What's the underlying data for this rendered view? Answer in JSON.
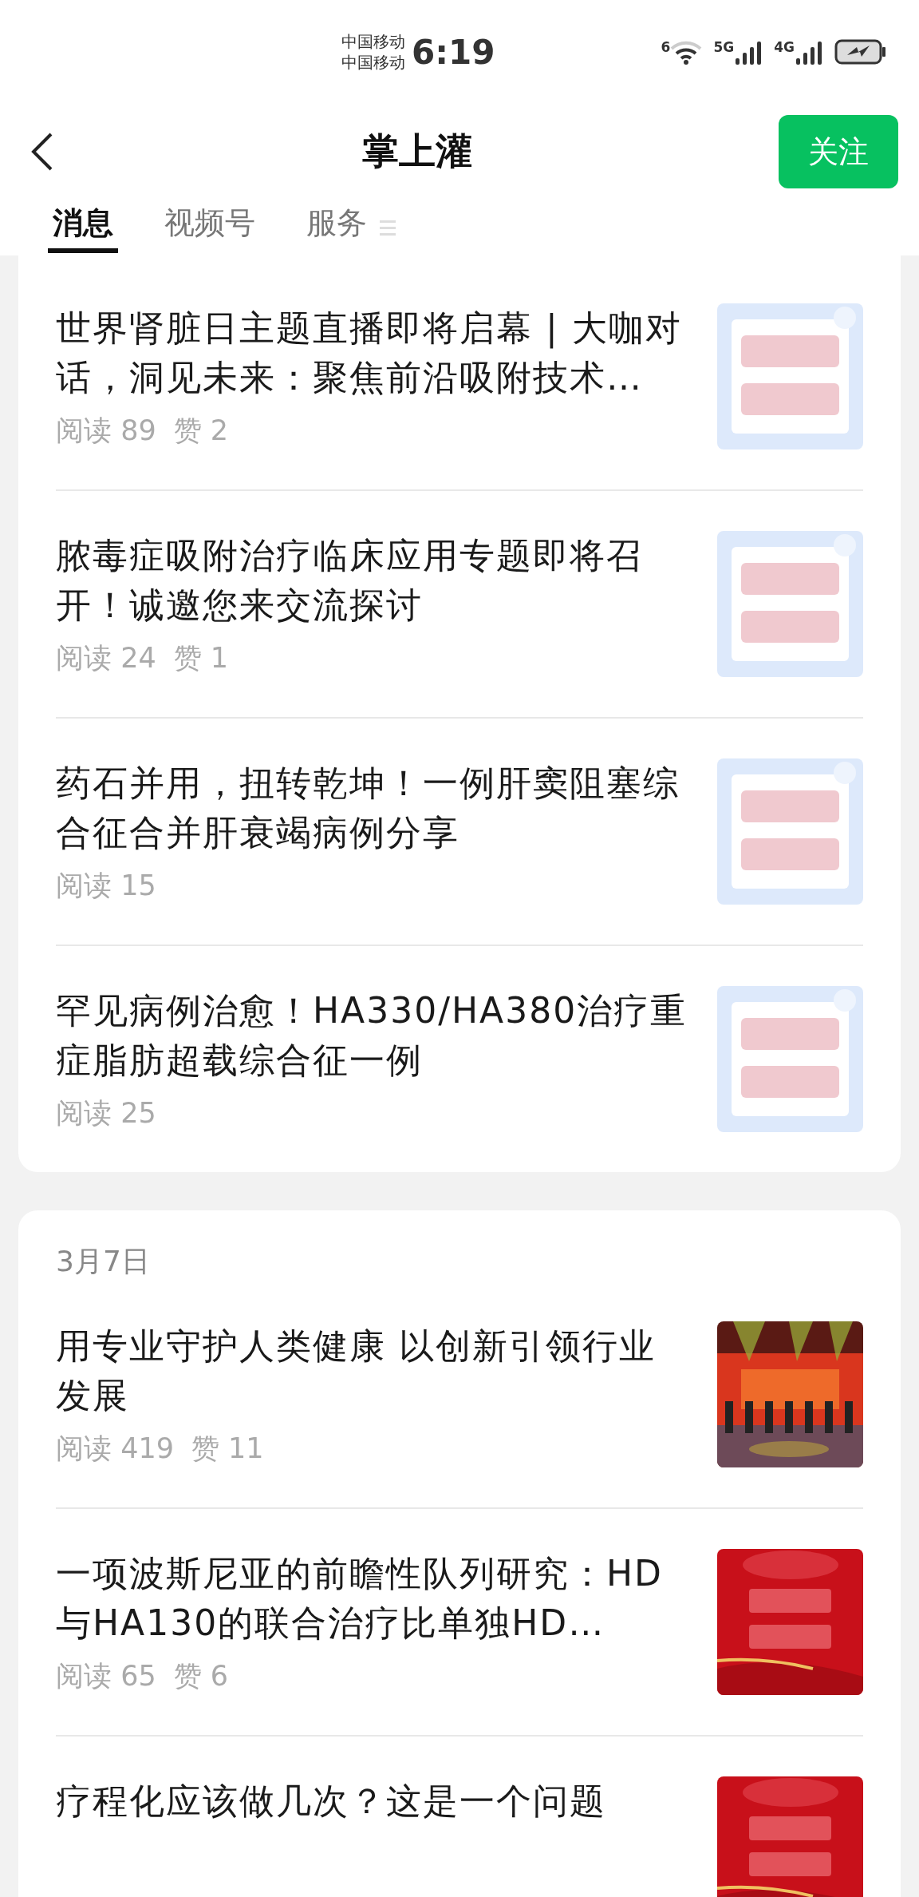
{
  "status_bar": {
    "carriers": [
      "中国移动",
      "中国移动"
    ],
    "time": "6:19",
    "wifi_label": "6",
    "signals": [
      {
        "label": "5G"
      },
      {
        "label": "4G"
      }
    ]
  },
  "header": {
    "title": "掌上灌",
    "follow_button": "关注"
  },
  "tabs": [
    {
      "label": "消息",
      "selected": true
    },
    {
      "label": "视频号",
      "selected": false
    },
    {
      "label": "服务",
      "selected": false
    }
  ],
  "groups": [
    {
      "articles": [
        {
          "title": "世界肾脏日主题直播即将启幕 | 大咖对话，洞见未来：聚焦前沿吸附技术…",
          "reads": "阅读 89",
          "likes": "赞 2",
          "thumb": {
            "kind": "light"
          }
        },
        {
          "title": "脓毒症吸附治疗临床应用专题即将召开！诚邀您来交流探讨",
          "reads": "阅读 24",
          "likes": "赞 1",
          "thumb": {
            "kind": "light"
          }
        },
        {
          "title": "药石并用，扭转乾坤！一例肝窦阻塞综合征合并肝衰竭病例分享",
          "reads": "阅读 15",
          "thumb": {
            "kind": "light"
          }
        },
        {
          "title": "罕见病例治愈！HA330/HA380治疗重症脂肪超载综合征一例",
          "reads": "阅读 25",
          "thumb": {
            "kind": "light"
          }
        }
      ]
    },
    {
      "date": "3月7日",
      "articles": [
        {
          "title": "用专业守护人类健康 以创新引领行业发展",
          "reads": "阅读 419",
          "likes": "赞 11"
        },
        {
          "title": "一项波斯尼亚的前瞻性队列研究：HD与HA130的联合治疗比单独HD…",
          "reads": "阅读 65",
          "likes": "赞 6",
          "thumb": {
            "kind": "red"
          }
        },
        {
          "title": "疗程化应该做几次？这是一个问题",
          "thumb": {
            "kind": "red"
          }
        }
      ]
    }
  ]
}
